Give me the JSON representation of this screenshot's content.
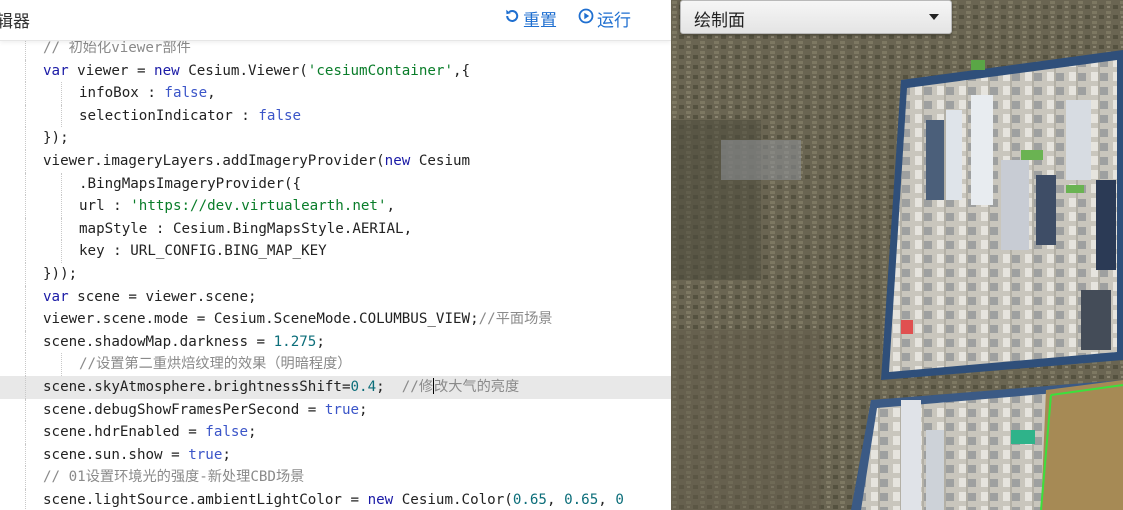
{
  "editor": {
    "title": "辑器",
    "reset_label": "重置",
    "run_label": "运行"
  },
  "code_lines": [
    "// 初始化viewer部件",
    "var viewer = new Cesium.Viewer('cesiumContainer',{",
    "infoBox : false,",
    "selectionIndicator : false",
    "});",
    "viewer.imageryLayers.addImageryProvider(new Cesium",
    ".BingMapsImageryProvider({",
    "url : 'https://dev.virtualearth.net',",
    "mapStyle : Cesium.BingMapsStyle.AERIAL,",
    "key : URL_CONFIG.BING_MAP_KEY",
    "}));",
    "var scene = viewer.scene;",
    "viewer.scene.mode = Cesium.SceneMode.COLUMBUS_VIEW;//平面场景",
    "scene.shadowMap.darkness = 1.275;",
    "//设置第二重烘焙纹理的效果（明暗程度）",
    "scene.skyAtmosphere.brightnessShift=0.4;  //修改大气的亮度",
    "scene.debugShowFramesPerSecond = true;",
    "scene.hdrEnabled = false;",
    "scene.sun.show = true;",
    "// 01设置环境光的强度-新处理CBD场景",
    "scene.lightSource.ambientLightColor = new Cesium.Color(0.65, 0.65, 0"
  ],
  "map": {
    "dropdown_value": "绘制面"
  },
  "icons": {
    "reset": "reset-icon",
    "run": "play-circle-icon"
  },
  "colors": {
    "accent": "#1f6fd0",
    "keyword": "#1a1aa6",
    "string": "#0a7d2a",
    "number": "#0c6e7a",
    "comment": "#8a8a8a"
  }
}
